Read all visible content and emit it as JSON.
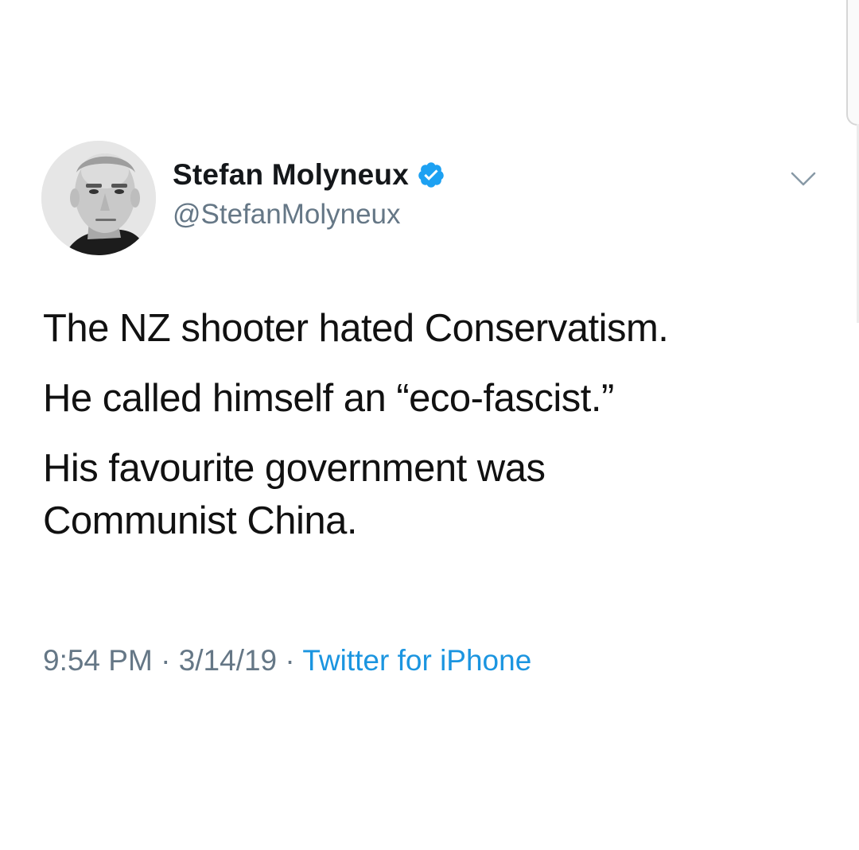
{
  "tweet": {
    "author": {
      "display_name": "Stefan Molyneux",
      "handle": "@StefanMolyneux",
      "verified": true,
      "avatar_icon": "profile-photo-grayscale"
    },
    "paragraphs": [
      "The NZ shooter hated Conservatism.",
      "He called himself an “eco-fascist.”",
      "His favourite government was Communist China."
    ],
    "time": "9:54 PM",
    "date": "3/14/19",
    "separator": "·",
    "source": "Twitter for iPhone"
  },
  "icons": {
    "verified": "verified-badge-icon",
    "menu": "chevron-down-icon"
  },
  "colors": {
    "verified_blue": "#1da1f2",
    "link_blue": "#1b95e0",
    "meta_gray": "#657786",
    "text": "#14171a",
    "background": "#ffffff"
  }
}
